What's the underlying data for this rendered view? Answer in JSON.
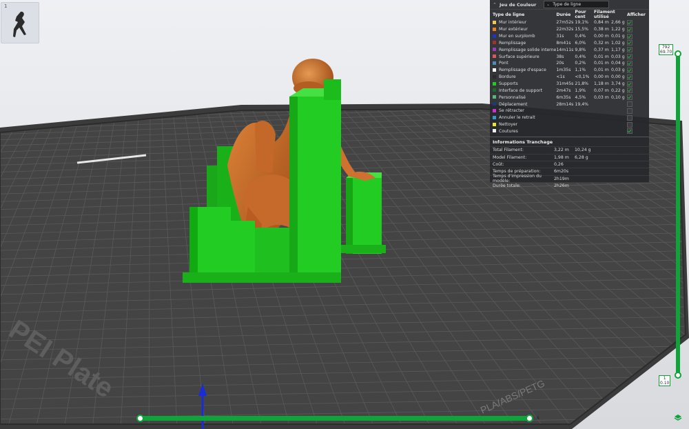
{
  "thumbnail": {
    "index": "1"
  },
  "panel": {
    "title": "Jeu de Couleur",
    "view_type": "Type de ligne",
    "headers": [
      "Type de ligne",
      "Durée",
      "Pour cent",
      "Filament utilisé",
      "Afficher"
    ],
    "rows": [
      {
        "label": "Mur intérieur",
        "color": "#f2c94c",
        "time": "27m52s",
        "pct": "19,1%",
        "len": "0,84 m",
        "wt": "2,66 g",
        "show": true
      },
      {
        "label": "Mur extérieur",
        "color": "#f07c23",
        "time": "22m32s",
        "pct": "15,5%",
        "len": "0,38 m",
        "wt": "1,22 g",
        "show": true
      },
      {
        "label": "Mur en surplomb",
        "color": "#2233cc",
        "time": "31s",
        "pct": "0,4%",
        "len": "0,00 m",
        "wt": "0,01 g",
        "show": true
      },
      {
        "label": "Remplissage",
        "color": "#a3322a",
        "time": "8m41s",
        "pct": "6,0%",
        "len": "0,32 m",
        "wt": "1,02 g",
        "show": true
      },
      {
        "label": "Remplissage solide interne",
        "color": "#9b3bb5",
        "time": "14m11s",
        "pct": "9,8%",
        "len": "0,37 m",
        "wt": "1,17 g",
        "show": true
      },
      {
        "label": "Surface supérieure",
        "color": "#d85a5a",
        "time": "38s",
        "pct": "0,4%",
        "len": "0,01 m",
        "wt": "0,03 g",
        "show": true
      },
      {
        "label": "Pont",
        "color": "#4a8fb8",
        "time": "20s",
        "pct": "0,2%",
        "len": "0,01 m",
        "wt": "0,04 g",
        "show": true
      },
      {
        "label": "Remplissage d'espace",
        "color": "#ffffff",
        "time": "1m35s",
        "pct": "1,1%",
        "len": "0,01 m",
        "wt": "0,03 g",
        "show": true
      },
      {
        "label": "Bordure",
        "color": "#2a2a2a",
        "time": "<1s",
        "pct": "<0,1%",
        "len": "0,00 m",
        "wt": "0,00 g",
        "show": true
      },
      {
        "label": "Supports",
        "color": "#22cc22",
        "time": "31m45s",
        "pct": "21,8%",
        "len": "1,18 m",
        "wt": "3,74 g",
        "show": true
      },
      {
        "label": "Interface de support",
        "color": "#1e6b28",
        "time": "2m47s",
        "pct": "1,9%",
        "len": "0,07 m",
        "wt": "0,22 g",
        "show": true
      },
      {
        "label": "Personnalisé",
        "color": "#55b97a",
        "time": "6m35s",
        "pct": "4,5%",
        "len": "0,03 m",
        "wt": "0,10 g",
        "show": true
      },
      {
        "label": "Déplacement",
        "color": "#1a3a7a",
        "time": "28m14s",
        "pct": "19,4%",
        "len": "",
        "wt": "",
        "show": false
      },
      {
        "label": "Se rétracter",
        "color": "#cc33cc",
        "time": "",
        "pct": "",
        "len": "",
        "wt": "",
        "show": false
      },
      {
        "label": "Annuler le retrait",
        "color": "#3399cc",
        "time": "",
        "pct": "",
        "len": "",
        "wt": "",
        "show": false
      },
      {
        "label": "Nettoyer",
        "color": "#e6e633",
        "time": "",
        "pct": "",
        "len": "",
        "wt": "",
        "show": false
      },
      {
        "label": "Coutures",
        "color": "#eeeeee",
        "time": "",
        "pct": "",
        "len": "",
        "wt": "",
        "show": true
      }
    ],
    "slice_title": "Informations Tranchage",
    "slice_rows": [
      {
        "k": "Total Filament:",
        "v1": "3,22 m",
        "v2": "10,24 g"
      },
      {
        "k": "Model Filament:",
        "v1": "1,98 m",
        "v2": "6,28 g"
      },
      {
        "k": "Coût:",
        "v1": "0,26",
        "v2": ""
      },
      {
        "k": "Temps de préparation:",
        "v1": "6m20s",
        "v2": ""
      },
      {
        "k": "Temps d'impression du modèle:",
        "v1": "2h19m",
        "v2": ""
      },
      {
        "k": "Durée totale:",
        "v1": "2h26m",
        "v2": ""
      }
    ]
  },
  "layer_slider": {
    "top_layer": "792",
    "top_height": "69.70",
    "bottom_layer": "1",
    "bottom_height": "0.10"
  },
  "move_slider": {
    "value": "6",
    "fraction": 1.0
  },
  "plate": {
    "brand_text": "PEI Plate",
    "material_text": "PLA/ABS/PETG"
  },
  "colors": {
    "slider": "#0fa33a",
    "support": "#22cc22",
    "model": "#c86a2a",
    "bed": "#3b3b3b"
  }
}
